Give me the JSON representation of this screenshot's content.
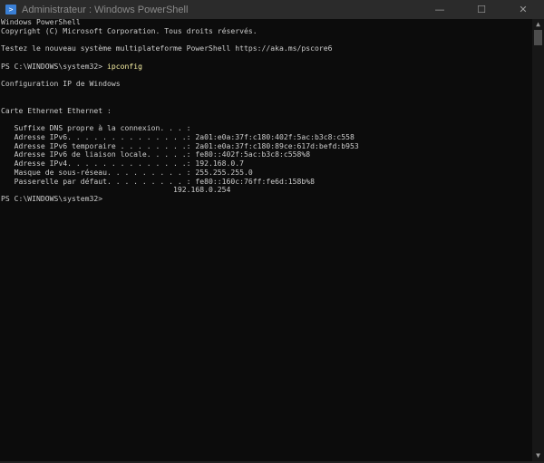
{
  "window": {
    "title": "Administrateur : Windows PowerShell",
    "icon": "powershell-icon",
    "minimize": "—",
    "maximize": "☐",
    "close": "✕"
  },
  "console": {
    "lines": [
      "Windows PowerShell",
      "Copyright (C) Microsoft Corporation. Tous droits réservés.",
      "",
      "Testez le nouveau système multiplateforme PowerShell https://aka.ms/pscore6",
      "",
      "",
      "",
      "Configuration IP de Windows",
      "",
      "",
      "Carte Ethernet Ethernet :",
      "",
      "   Suffixe DNS propre à la connexion. . . :",
      "   Adresse IPv6. . . . . . . . . . . . . .: 2a01:e0a:37f:c180:402f:5ac:b3c8:c558",
      "   Adresse IPv6 temporaire . . . . . . . .: 2a01:e0a:37f:c180:89ce:617d:befd:b953",
      "   Adresse IPv6 de liaison locale. . . . .: fe80::402f:5ac:b3c8:c558%8",
      "   Adresse IPv4. . . . . . . . . . . . . .: 192.168.0.7",
      "   Masque de sous-réseau. . . . . . . . . : 255.255.255.0",
      "   Passerelle par défaut. . . . . . . . . : fe80::160c:76ff:fe6d:158b%8",
      "                                       192.168.0.254",
      "PS C:\\WINDOWS\\system32>"
    ],
    "prompt": "PS C:\\WINDOWS\\system32> ",
    "command": "ipconfig"
  },
  "colors": {
    "command": "#f9f1a5",
    "text": "#cccccc",
    "background": "#0c0c0c"
  }
}
